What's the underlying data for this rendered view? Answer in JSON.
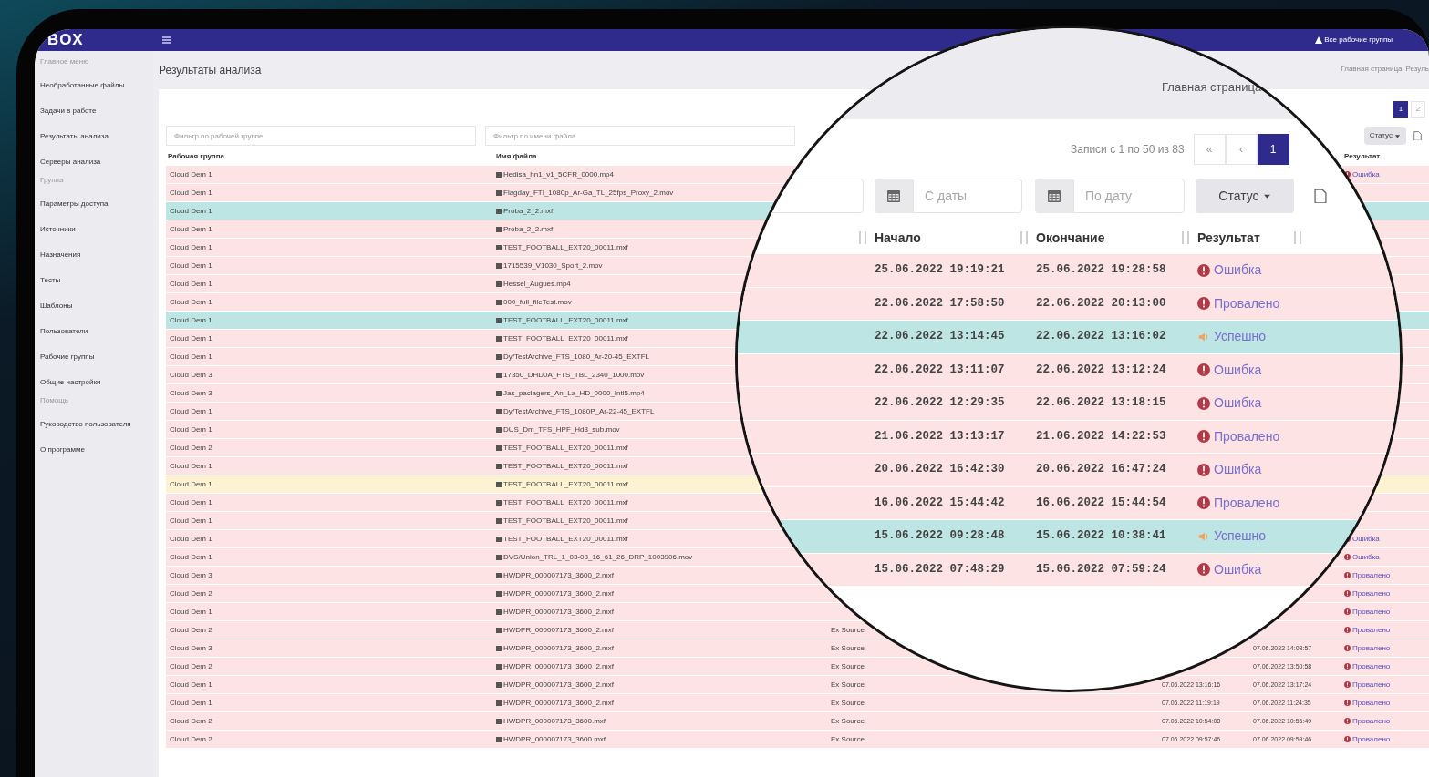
{
  "topbar": {
    "logo": "BOX",
    "workgroups": "Все рабочие группы"
  },
  "sidebar": {
    "items": [
      {
        "kind": "section",
        "label": "Главное меню"
      },
      {
        "kind": "link",
        "label": "Необработанные файлы"
      },
      {
        "kind": "link",
        "label": "Задачи в работе"
      },
      {
        "kind": "link",
        "label": "Результаты анализа"
      },
      {
        "kind": "link",
        "label": "Серверы анализа"
      },
      {
        "kind": "section",
        "label": "Группа"
      },
      {
        "kind": "link",
        "label": "Параметры доступа"
      },
      {
        "kind": "link",
        "label": "Источники"
      },
      {
        "kind": "link",
        "label": "Назначения"
      },
      {
        "kind": "link",
        "label": "Тесты"
      },
      {
        "kind": "link",
        "label": "Шаблоны"
      },
      {
        "kind": "link",
        "label": "Пользователи"
      },
      {
        "kind": "link",
        "label": "Рабочие группы"
      },
      {
        "kind": "link",
        "label": "Общие настройки"
      },
      {
        "kind": "section",
        "label": "Помощь"
      },
      {
        "kind": "link",
        "label": "Руководство пользователя"
      },
      {
        "kind": "link",
        "label": "О программе"
      }
    ]
  },
  "page": {
    "title": "Результаты анализа",
    "breadcrumb": "Главная страница",
    "breadcrumb_current": "Резуль"
  },
  "pagination": {
    "pages": [
      {
        "label": "1",
        "selected": true
      },
      {
        "label": "2",
        "selected": false
      }
    ]
  },
  "status_button": "Статус",
  "filters": [
    {
      "placeholder": "Фильтр по рабочей группе"
    },
    {
      "placeholder": "Фильтр по имени файла"
    }
  ],
  "table": {
    "columns": [
      "Рабочая группа",
      "Имя файла",
      "Результат"
    ],
    "rows": [
      {
        "kind": "error",
        "group": "Cloud Dem 1",
        "file": "Hedisa_hn1_v1_5CFR_0000.mp4",
        "result": "Ошибка"
      },
      {
        "kind": "failed",
        "group": "Cloud Dem 1",
        "file": "Flagday_FTI_1080p_Ar-Ga_TL_25fps_Proxy_2.mov"
      },
      {
        "kind": "success",
        "group": "Cloud Dem 1",
        "file": "Proba_2_2.mxf"
      },
      {
        "kind": "error",
        "group": "Cloud Dem 1",
        "file": "Proba_2_2.mxf"
      },
      {
        "kind": "error",
        "group": "Cloud Dem 1",
        "file": "TEST_FOOTBALL_EXT20_00011.mxf"
      },
      {
        "kind": "error",
        "group": "Cloud Dem 1",
        "file": "1715539_V1030_Sport_2.mov"
      },
      {
        "kind": "error",
        "group": "Cloud Dem 1",
        "file": "Hessel_Augues.mp4"
      },
      {
        "kind": "error",
        "group": "Cloud Dem 1",
        "file": "000_full_fileTest.mov"
      },
      {
        "kind": "success",
        "group": "Cloud Dem 1",
        "file": "TEST_FOOTBALL_EXT20_00011.mxf"
      },
      {
        "kind": "error",
        "group": "Cloud Dem 1",
        "file": "TEST_FOOTBALL_EXT20_00011.mxf"
      },
      {
        "kind": "error",
        "group": "Cloud Dem 1",
        "file": "Dy/TestArchive_FTS_1080_Ar-20-45_EXTFL"
      },
      {
        "kind": "error",
        "group": "Cloud Dem 3",
        "file": "17350_DHD0A_FTS_TBL_2340_1000.mov"
      },
      {
        "kind": "error",
        "group": "Cloud Dem 3",
        "file": "Jas_paclagers_An_La_HD_0000_Intl5.mp4"
      },
      {
        "kind": "error",
        "group": "Cloud Dem 1",
        "file": "Dy/TestArchive_FTS_1080P_Ar-22-45_EXTFL"
      },
      {
        "kind": "error",
        "group": "Cloud Dem 1",
        "file": "DUS_Dm_TFS_HPF_Hd3_sub.mov"
      },
      {
        "kind": "error",
        "group": "Cloud Dem 2",
        "file": "TEST_FOOTBALL_EXT20_00011.mxf"
      },
      {
        "kind": "error",
        "group": "Cloud Dem 1",
        "file": "TEST_FOOTBALL_EXT20_00011.mxf"
      },
      {
        "kind": "warning",
        "group": "Cloud Dem 1",
        "file": "TEST_FOOTBALL_EXT20_00011.mxf"
      },
      {
        "kind": "error",
        "group": "Cloud Dem 1",
        "file": "TEST_FOOTBALL_EXT20_00011.mxf"
      },
      {
        "kind": "error",
        "group": "Cloud Dem 1",
        "file": "TEST_FOOTBALL_EXT20_00011.mxf"
      },
      {
        "kind": "error",
        "group": "Cloud Dem 1",
        "file": "TEST_FOOTBALL_EXT20_00011.mxf",
        "result": "Ошибка"
      },
      {
        "kind": "error",
        "group": "Cloud Dem 1",
        "file": "DVS/Union_TRL_1_03-03_16_61_26_DRP_1003906.mov",
        "result": "Ошибка"
      },
      {
        "kind": "error",
        "group": "Cloud Dem 3",
        "file": "HWDPR_000007173_3600_2.mxf",
        "result": "Провалено"
      },
      {
        "kind": "error",
        "group": "Cloud Dem 2",
        "file": "HWDPR_000007173_3600_2.mxf",
        "result": "Провалено"
      },
      {
        "kind": "error",
        "group": "Cloud Dem 1",
        "file": "HWDPR_000007173_3600_2.mxf",
        "result": "Провалено"
      },
      {
        "kind": "error",
        "group": "Cloud Dem 2",
        "file": "HWDPR_000007173_3600_2.mxf",
        "source": "Ex Source",
        "result": "Провалено"
      },
      {
        "kind": "error",
        "group": "Cloud Dem 3",
        "file": "HWDPR_000007173_3600_2.mxf",
        "source": "Ex Source",
        "end": "07.06.2022 14:03:57",
        "result": "Провалено"
      },
      {
        "kind": "error",
        "group": "Cloud Dem 2",
        "file": "HWDPR_000007173_3600_2.mxf",
        "source": "Ex Source",
        "end": "07.06.2022 13:50:58",
        "result": "Провалено"
      },
      {
        "kind": "error",
        "group": "Cloud Dem 1",
        "file": "HWDPR_000007173_3600_2.mxf",
        "source": "Ex Source",
        "start": "07.06.2022 13:16:16",
        "end": "07.06.2022 13:17:24",
        "result": "Провалено"
      },
      {
        "kind": "error",
        "group": "Cloud Dem 1",
        "file": "HWDPR_000007173_3600_2.mxf",
        "source": "Ex Source",
        "start": "07.06.2022 11:19:19",
        "end": "07.06.2022 11:24:35",
        "result": "Провалено"
      },
      {
        "kind": "error",
        "group": "Cloud Dem 2",
        "file": "HWDPR_000007173_3600.mxf",
        "source": "Ex Source",
        "start": "07.06.2022 10:54:08",
        "end": "07.06.2022 10:56:49",
        "result": "Провалено"
      },
      {
        "kind": "error",
        "group": "Cloud Dem 2",
        "file": "HWDPR_000007173_3600.mxf",
        "source": "Ex Source",
        "start": "07.06.2022 09:57:46",
        "end": "07.06.2022 09:59:46",
        "result": "Провалено"
      }
    ]
  },
  "magnifier": {
    "breadcrumb": "Главная страница",
    "records": "Записи с 1 по 50 из 83",
    "pages": [
      {
        "label": "«",
        "selected": false
      },
      {
        "label": "‹",
        "selected": false
      },
      {
        "label": "1",
        "selected": true
      }
    ],
    "from_placeholder": "С даты",
    "to_placeholder": "По дату",
    "status_button": "Статус",
    "columns": [
      "Начало",
      "Окончание",
      "Результат"
    ],
    "rows": [
      {
        "kind": "error",
        "start": "25.06.2022 19:19:21",
        "end": "25.06.2022 19:28:58",
        "result": "Ошибка"
      },
      {
        "kind": "failed",
        "start": "22.06.2022 17:58:50",
        "end": "22.06.2022 20:13:00",
        "result": "Провалено"
      },
      {
        "kind": "success",
        "start": "22.06.2022 13:14:45",
        "end": "22.06.2022 13:16:02",
        "result": "Успешно"
      },
      {
        "kind": "error",
        "start": "22.06.2022 13:11:07",
        "end": "22.06.2022 13:12:24",
        "result": "Ошибка"
      },
      {
        "kind": "error",
        "start": "22.06.2022 12:29:35",
        "end": "22.06.2022 13:18:15",
        "result": "Ошибка"
      },
      {
        "kind": "failed",
        "start": "21.06.2022 13:13:17",
        "end": "21.06.2022 14:22:53",
        "result": "Провалено"
      },
      {
        "kind": "error",
        "start": "20.06.2022 16:42:30",
        "end": "20.06.2022 16:47:24",
        "result": "Ошибка"
      },
      {
        "kind": "failed",
        "start": "16.06.2022 15:44:42",
        "end": "16.06.2022 15:44:54",
        "result": "Провалено"
      },
      {
        "kind": "success",
        "start": "15.06.2022 09:28:48",
        "end": "15.06.2022 10:38:41",
        "result": "Успешно"
      },
      {
        "kind": "error",
        "start": "15.06.2022 07:48:29",
        "end": "15.06.2022 07:59:24",
        "result": "Ошибка"
      }
    ]
  }
}
